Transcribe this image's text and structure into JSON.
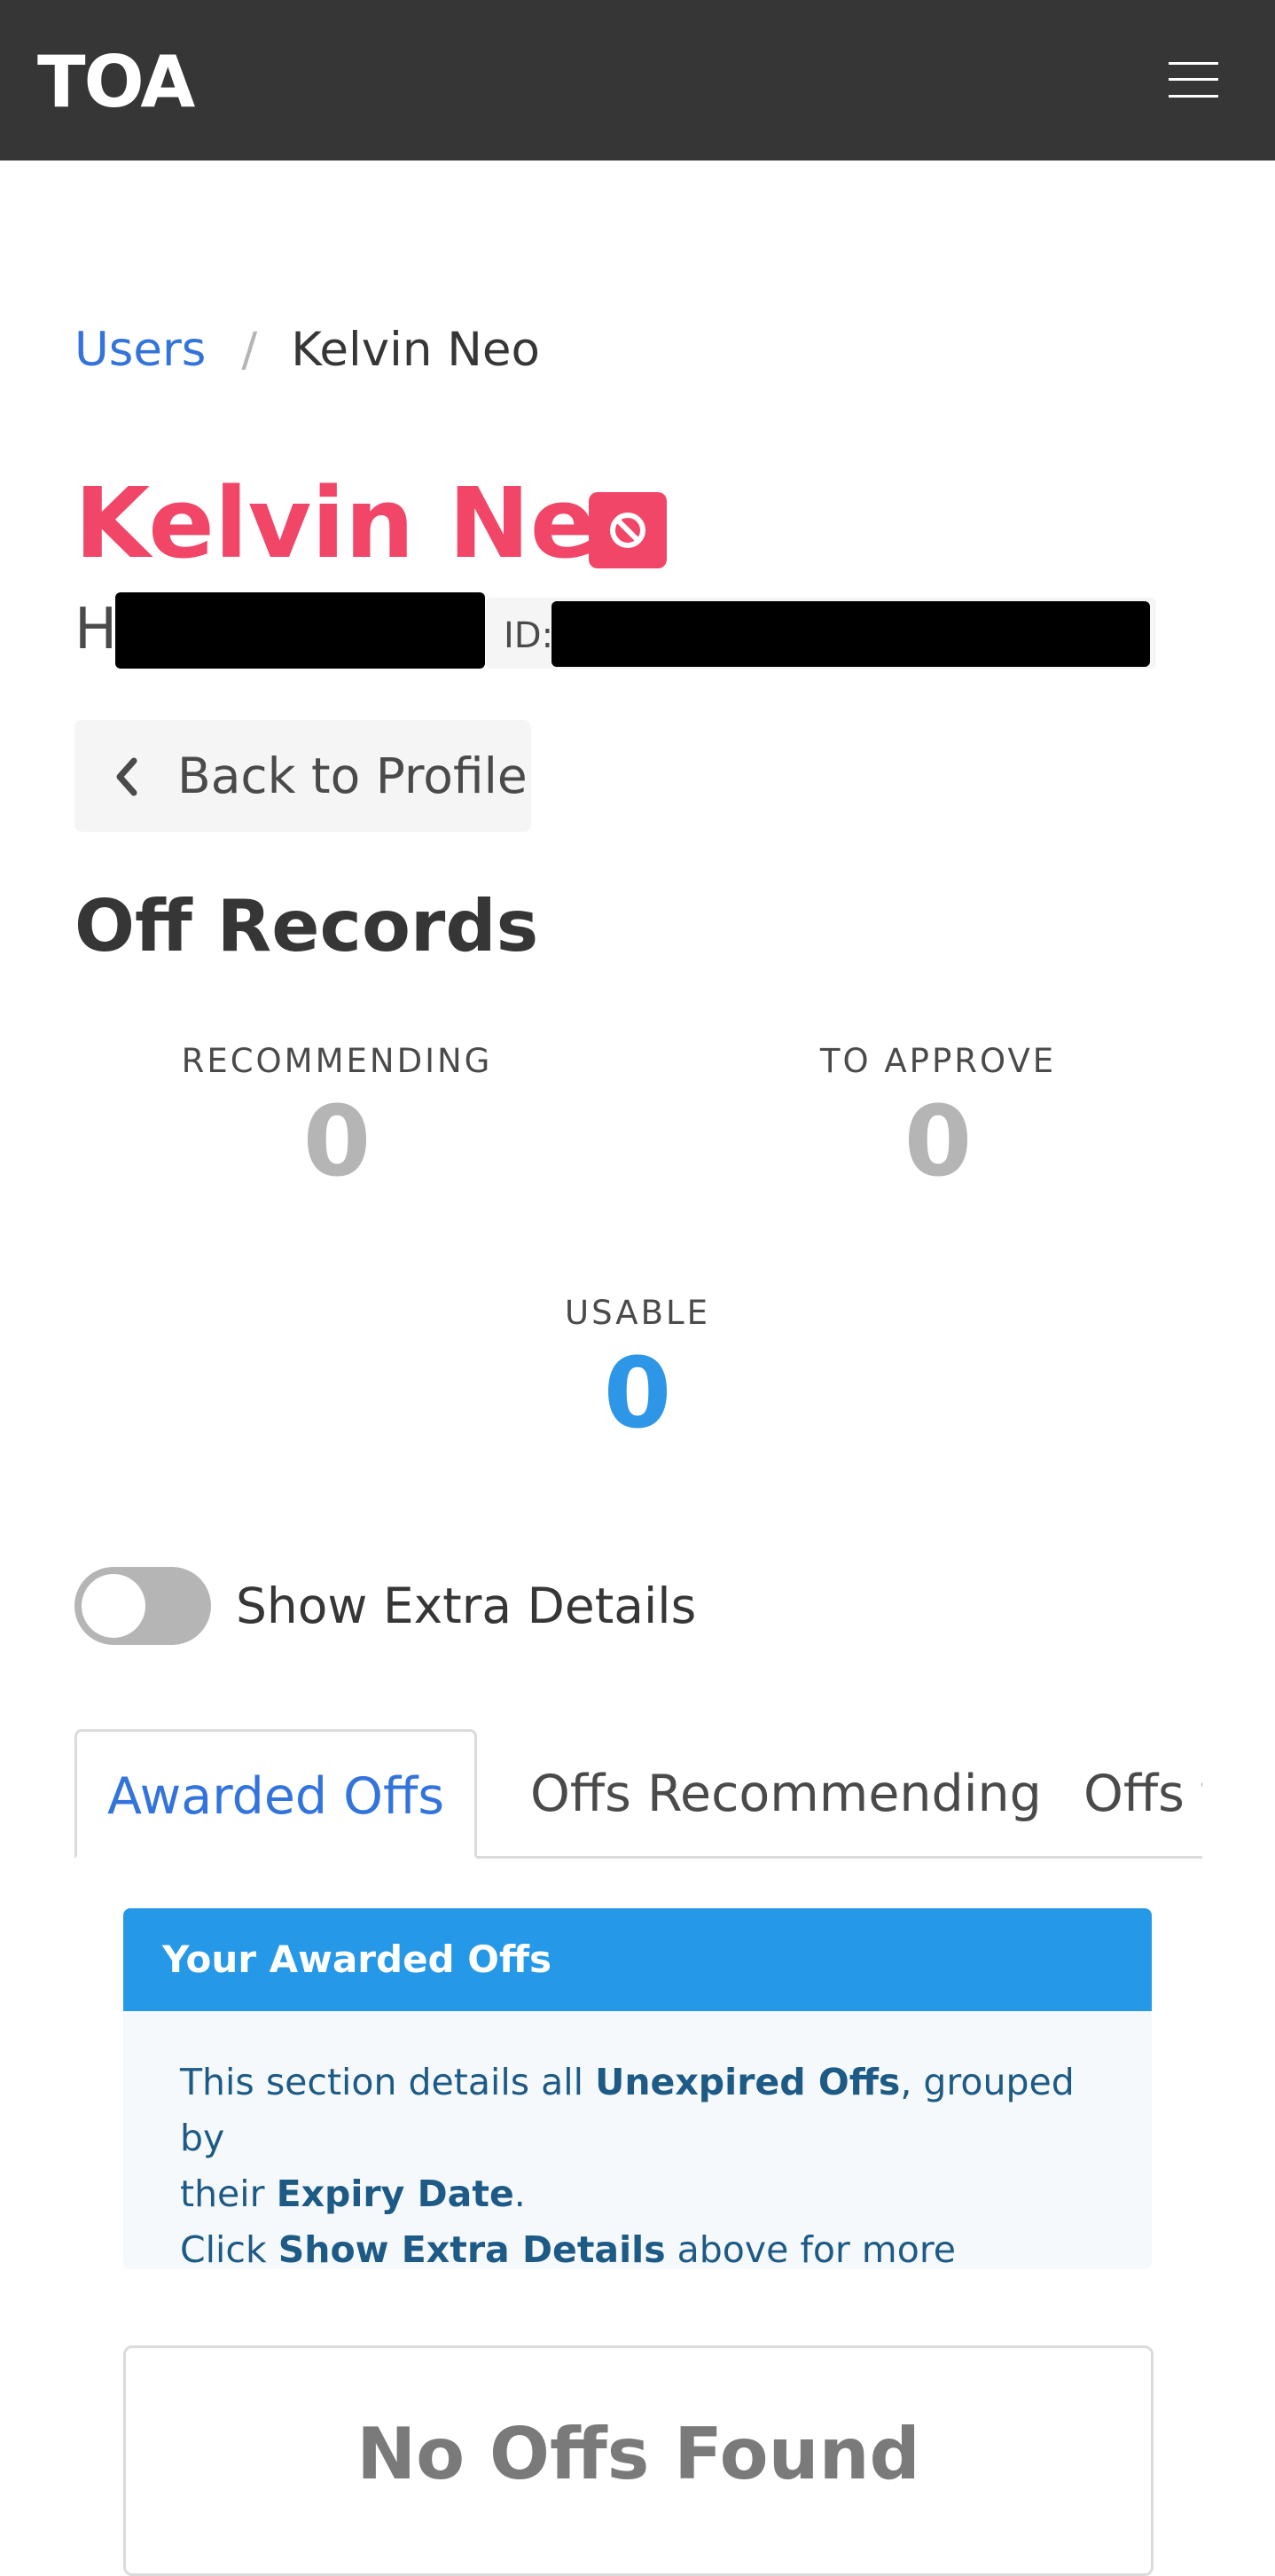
{
  "navbar": {
    "brand": "TOA",
    "menu_icon": "hamburger-menu-icon"
  },
  "breadcrumb": {
    "parent": "Users",
    "separator": "/",
    "current": "Kelvin Neo"
  },
  "user": {
    "name": "Kelvin Neo",
    "status_icon": "ban-icon",
    "sub_prefix": "H",
    "id_label": "ID:"
  },
  "actions": {
    "back_label": "Back to Profile",
    "back_icon": "chevron-left-icon"
  },
  "section": {
    "title": "Off Records"
  },
  "stats": {
    "recommending": {
      "label": "RECOMMENDING",
      "value": "0"
    },
    "to_approve": {
      "label": "TO APPROVE",
      "value": "0"
    },
    "usable": {
      "label": "USABLE",
      "value": "0"
    }
  },
  "toggle": {
    "label": "Show Extra Details",
    "checked": false
  },
  "tabs": [
    {
      "label": "Awarded Offs",
      "active": true
    },
    {
      "label": "Offs Recommending",
      "active": false
    },
    {
      "label": "Offs t",
      "active": false
    }
  ],
  "message": {
    "header": "Your Awarded Offs",
    "line1_a": "This section details all ",
    "line1_b": "Unexpired Offs",
    "line1_c": ", grouped by",
    "line2_a": "their ",
    "line2_b": "Expiry Date",
    "line2_c": ".",
    "line3_a": "Click ",
    "line3_b": "Show Extra Details",
    "line3_c": " above for more information."
  },
  "empty_state": {
    "text": "No Offs Found"
  },
  "colors": {
    "navbar_bg": "#363636",
    "link": "#3273dc",
    "danger": "#f14668",
    "info": "#2598e8",
    "usable_number": "#2d96e6",
    "muted_number": "#b5b5b5"
  }
}
